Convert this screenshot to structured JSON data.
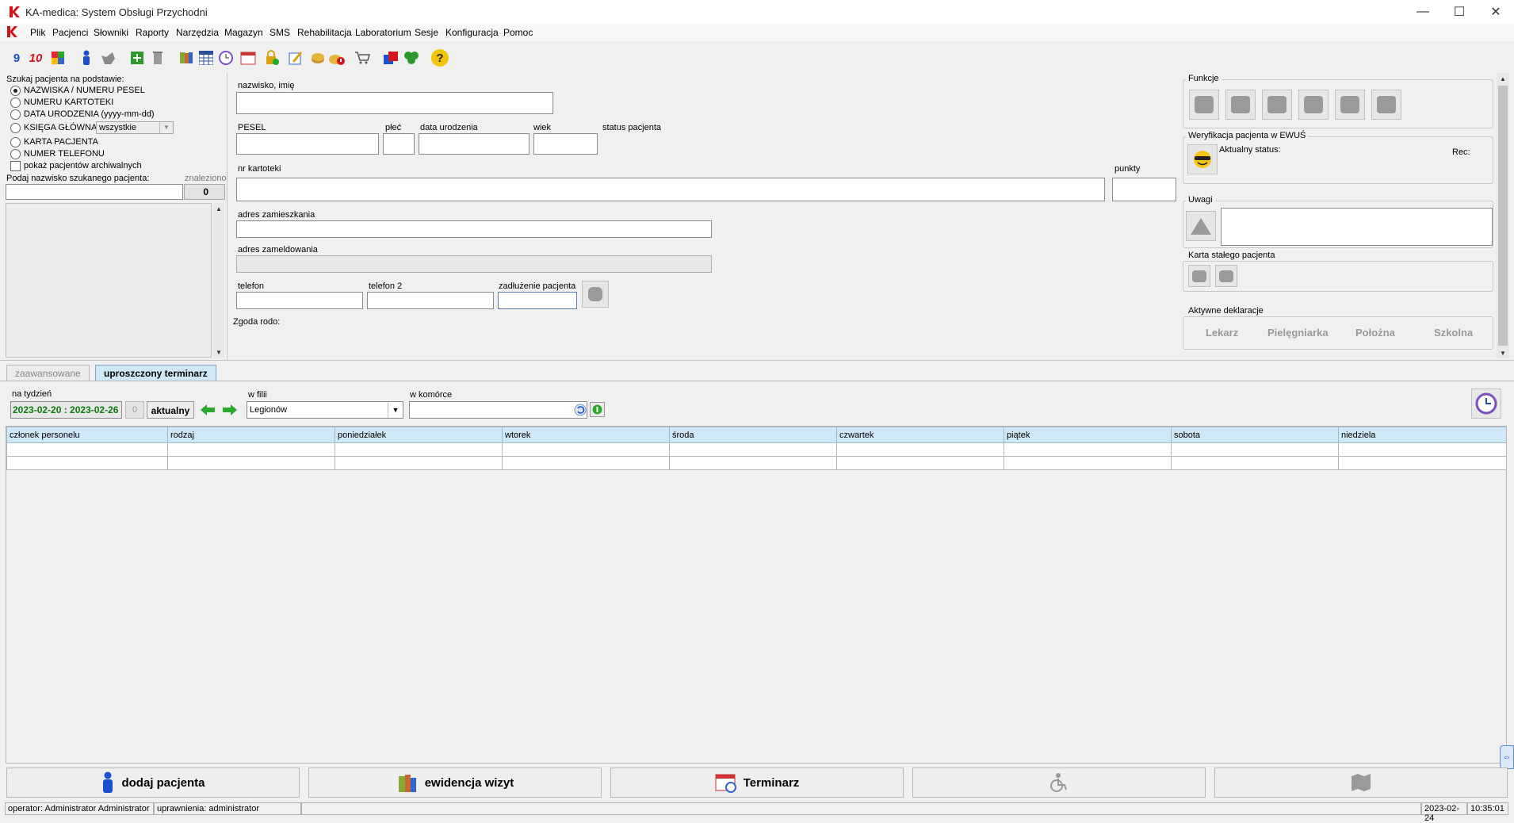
{
  "window": {
    "title": "KA-medica: System Obsługi Przychodni",
    "minimize": "—",
    "maximize": "☐",
    "close": "✕"
  },
  "menu": [
    "Plik",
    "Pacjenci",
    "Słowniki",
    "Raporty",
    "Narzędzia",
    "Magazyn",
    "SMS",
    "Rehabilitacja",
    "Laboratorium",
    "Sesje",
    "Konfiguracja",
    "Pomoc"
  ],
  "toolbar": {
    "btn1": "9",
    "btn2": "10",
    "help": "?"
  },
  "search": {
    "heading": "Szukaj pacjenta na podstawie:",
    "options": [
      "NAZWISKA / NUMERU PESEL",
      "NUMERU KARTOTEKI",
      "DATA URODZENIA (yyyy-mm-dd)",
      "KSIĘGA GŁÓWNA",
      "KARTA PACJENTA",
      "NUMER TELEFONU"
    ],
    "selected_index": 0,
    "ksiega_select": "wszystkie",
    "archive_checkbox": "pokaż pacjentów archiwalnych",
    "name_prompt": "Podaj nazwisko szukanego pacjenta:",
    "found_label": "znaleziono",
    "found_count": "0"
  },
  "patient": {
    "name_label": "nazwisko, imię",
    "pesel_label": "PESEL",
    "sex_label": "płeć",
    "birth_label": "data urodzenia",
    "age_label": "wiek",
    "status_label": "status pacjenta",
    "record_label": "nr kartoteki",
    "points_label": "punkty",
    "address_label": "adres zamieszkania",
    "registered_address_label": "adres zameldowania",
    "phone_label": "telefon",
    "phone2_label": "telefon 2",
    "debt_label": "zadłużenie pacjenta",
    "rodo_label": "Zgoda rodo:"
  },
  "right": {
    "funkcje_title": "Funkcje",
    "ewus_title": "Weryfikacja pacjenta w EWUŚ",
    "ewus_status": "Aktualny status:",
    "ewus_rec": "Rec:",
    "uwagi_title": "Uwagi",
    "karta_title": "Karta stałego pacjenta",
    "deklaracje_title": "Aktywne deklaracje",
    "deklaracje": [
      "Lekarz",
      "Pielęgniarka",
      "Położna",
      "Szkolna"
    ]
  },
  "tabs": [
    "zaawansowane",
    "uproszczony terminarz"
  ],
  "schedule": {
    "week_label": "na tydzień",
    "week_value": "2023-02-20 : 2023-02-26",
    "week_counter": "0",
    "current_btn": "aktualny",
    "branch_label": "w filii",
    "branch_value": "Legionów",
    "cell_label": "w komórce",
    "columns": [
      "członek personelu",
      "rodzaj",
      "poniedziałek",
      "wtorek",
      "środa",
      "czwartek",
      "piątek",
      "sobota",
      "niedziela"
    ]
  },
  "bottom": {
    "add_patient": "dodaj pacjenta",
    "visits": "ewidencja wizyt",
    "scheduler": "Terminarz"
  },
  "statusbar": {
    "operator": "operator:  Administrator Administrator",
    "rights": "uprawnienia:  administrator",
    "date": "2023-02-24",
    "time": "10:35:01"
  },
  "colors": {
    "accent_red": "#d4141c",
    "header_blue": "#cfe8f7",
    "week_green": "#0a7a0a"
  }
}
